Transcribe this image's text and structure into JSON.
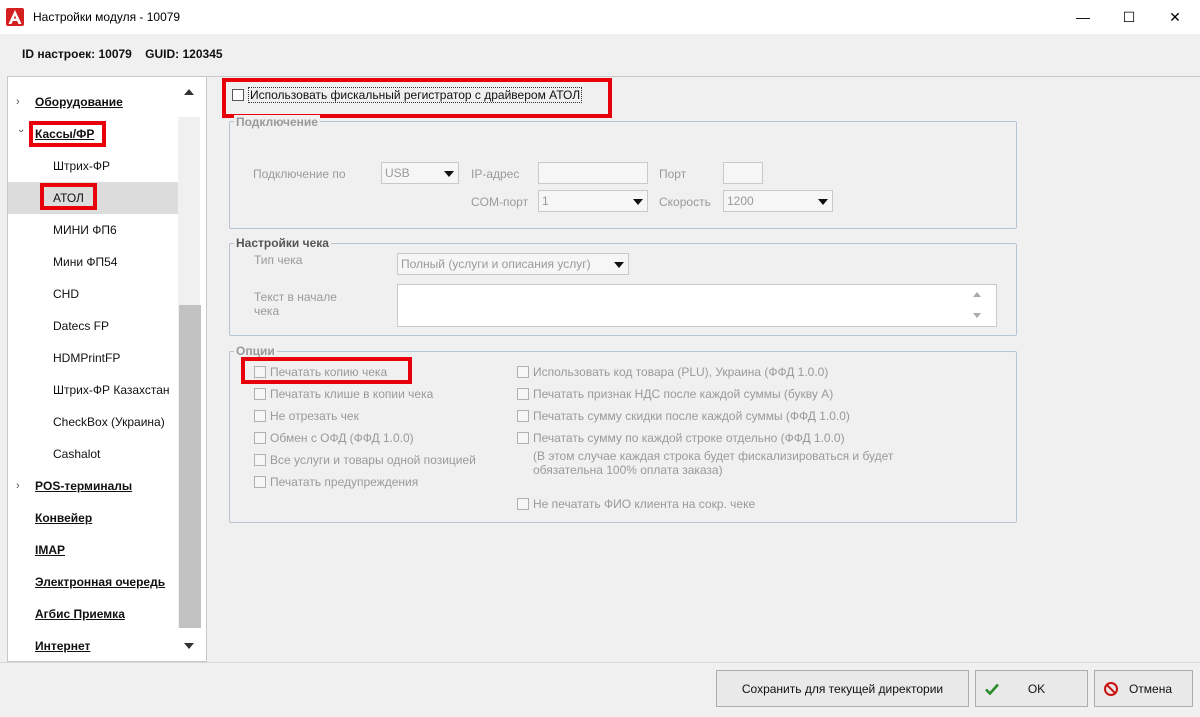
{
  "window": {
    "title": "Настройки модуля   - 10079",
    "minimize_glyph": "—",
    "maximize_glyph": "☐",
    "close_glyph": "✕"
  },
  "info_line": "ID настроек: 10079    GUID: 120345",
  "nav": {
    "items": [
      {
        "label": "Оборудование",
        "type": "group",
        "chevron": "right"
      },
      {
        "label": "Кассы/ФР",
        "type": "group",
        "chevron": "down"
      },
      {
        "label": "Штрих-ФР",
        "type": "sub"
      },
      {
        "label": "АТОЛ",
        "type": "sub",
        "selected": true
      },
      {
        "label": "МИНИ ФП6",
        "type": "sub"
      },
      {
        "label": "Мини ФП54",
        "type": "sub"
      },
      {
        "label": "CHD",
        "type": "sub"
      },
      {
        "label": "Datecs FP",
        "type": "sub"
      },
      {
        "label": "HDMPrintFP",
        "type": "sub"
      },
      {
        "label": "Штрих-ФР Казахстан",
        "type": "sub"
      },
      {
        "label": "CheckBox (Украина)",
        "type": "sub"
      },
      {
        "label": "Cashalot",
        "type": "sub"
      },
      {
        "label": "POS-терминалы",
        "type": "group",
        "chevron": "right"
      },
      {
        "label": "Конвейер",
        "type": "group"
      },
      {
        "label": "IMAP",
        "type": "group"
      },
      {
        "label": "Электронная очередь",
        "type": "group"
      },
      {
        "label": "Агбис Приемка",
        "type": "group"
      },
      {
        "label": "Интернет",
        "type": "group"
      }
    ]
  },
  "main": {
    "use_fiscal_checkbox": "Использовать фискальный регистратор с драйвером АТОЛ",
    "connection": {
      "title": "Подключение",
      "connect_via_label": "Подключение по",
      "connect_via_value": "USB",
      "ip_label": "IP-адрес",
      "ip_value": "",
      "port_label": "Порт",
      "port_value": "",
      "com_label": "COM-порт",
      "com_value": "1",
      "speed_label": "Скорость",
      "speed_value": "1200"
    },
    "receipt": {
      "title": "Настройки чека",
      "type_label": "Тип чека",
      "type_value": "Полный (услуги и описания услуг)",
      "header_text_label_1": "Текст в начале",
      "header_text_label_2": "чека",
      "header_text_value": ""
    },
    "options": {
      "title": "Опции",
      "left": [
        "Печатать копию чека",
        "Печатать клише в копии чека",
        "Не отрезать чек",
        "Обмен с ОФД (ФФД 1.0.0)",
        "Все услуги и товары одной позицией",
        "Печатать предупреждения"
      ],
      "right": [
        "Использовать код товара (PLU), Украина (ФФД 1.0.0)",
        "Печатать признак НДС после каждой суммы (букву А)",
        "Печатать сумму скидки после каждой суммы (ФФД 1.0.0)",
        "Печатать сумму по каждой строке отдельно (ФФД 1.0.0)"
      ],
      "note_line_1": "(В этом случае каждая строка будет фискализироваться и будет",
      "note_line_2": "обязательна 100% оплата заказа)",
      "no_client_name": "Не печатать ФИО клиента на сокр. чеке"
    }
  },
  "footer": {
    "save_label": "Сохранить для текущей директории",
    "ok_label": "OK",
    "cancel_label": "Отмена"
  },
  "colors": {
    "highlight": "#e8000a",
    "ok_icon": "#2a8a2a",
    "cancel_icon": "#cc1111",
    "app_icon": "#d42020"
  }
}
